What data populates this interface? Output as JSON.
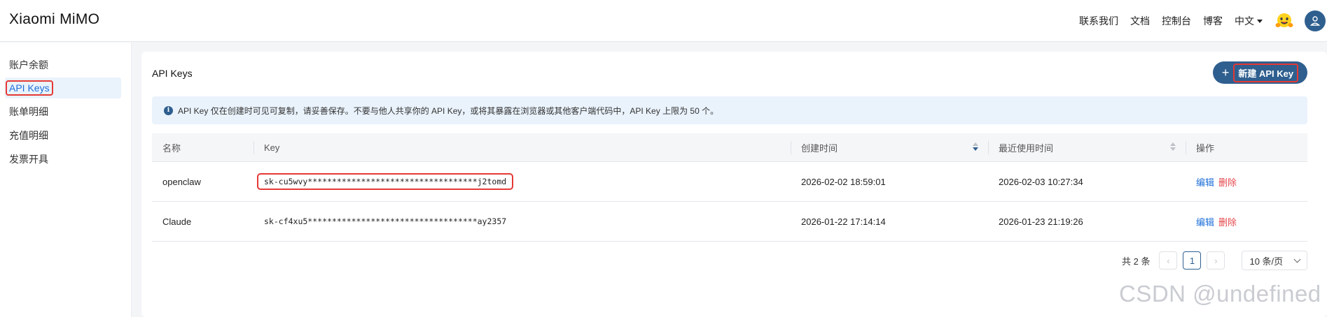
{
  "app": {
    "logo": "Xiaomi MiMO"
  },
  "topnav": {
    "links": [
      "联系我们",
      "文档",
      "控制台",
      "博客"
    ],
    "language": "中文"
  },
  "sidebar": {
    "items": [
      {
        "label": "账户余额",
        "active": false
      },
      {
        "label": "API Keys",
        "active": true
      },
      {
        "label": "账单明细",
        "active": false
      },
      {
        "label": "充值明细",
        "active": false
      },
      {
        "label": "发票开具",
        "active": false
      }
    ]
  },
  "main": {
    "title": "API Keys",
    "new_button_label": "新建 API Key",
    "notice": "API Key 仅在创建时可见可复制，请妥善保存。不要与他人共享你的 API Key，或将其暴露在浏览器或其他客户端代码中，API Key 上限为 50 个。"
  },
  "table": {
    "headers": {
      "name": "名称",
      "key": "Key",
      "created": "创建时间",
      "last_used": "最近使用时间",
      "actions": "操作"
    },
    "rows": [
      {
        "name": "openclaw",
        "key": "sk-cu5wvy***********************************j2tomd",
        "created": "2026-02-02 18:59:01",
        "last_used": "2026-02-03 10:27:34",
        "edit": "编辑",
        "delete": "删除"
      },
      {
        "name": "Claude",
        "key": "sk-cf4xu5***********************************ay2357",
        "created": "2026-01-22 17:14:14",
        "last_used": "2026-01-23 21:19:26",
        "edit": "编辑",
        "delete": "删除"
      }
    ]
  },
  "pagination": {
    "total": "共 2 条",
    "current_page": "1",
    "page_size": "10 条/页"
  },
  "watermark": "CSDN @undefined",
  "colors": {
    "accent": "#2f5f8f",
    "link": "#1e6fd9",
    "danger": "#e5484d",
    "highlight": "#e53935"
  }
}
